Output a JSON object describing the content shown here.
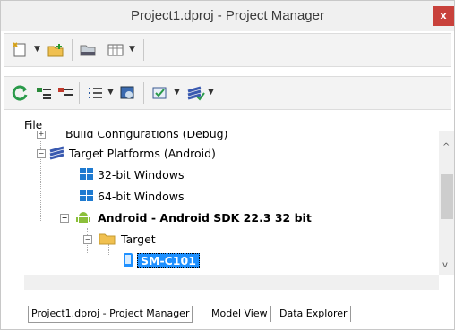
{
  "window": {
    "title": "Project1.dproj - Project Manager",
    "close_glyph": "x"
  },
  "toolbar1": {
    "icons": [
      "new-item-icon",
      "add-folder-icon",
      "folder-open-icon",
      "grid-view-icon"
    ]
  },
  "toolbar2": {
    "icons": [
      "refresh-icon",
      "expand-all-icon",
      "collapse-all-icon",
      "list-icon",
      "deploy-icon",
      "run-options-icon",
      "build-icon"
    ]
  },
  "file_label": "File",
  "tree": {
    "build_configurations": "Build Configurations (Debug)",
    "target_platforms": "Target Platforms (Android)",
    "win32": "32-bit Windows",
    "win64": "64-bit Windows",
    "android": "Android - Android SDK 22.3 32 bit",
    "target": "Target",
    "device": "SM-C101"
  },
  "tabs": [
    "Project1.dproj - Project Manager",
    "Model View",
    "Data Explorer"
  ],
  "colors": {
    "accent": "#1e90ff",
    "close": "#c8413b",
    "android": "#8bbf3a"
  }
}
